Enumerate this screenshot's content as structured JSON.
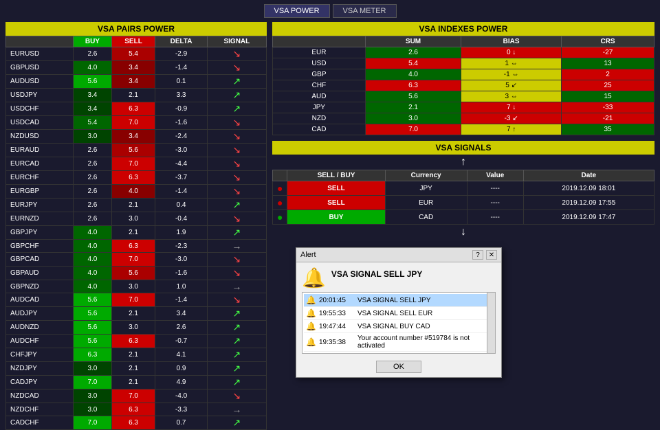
{
  "topBar": {
    "btn1": "VSA POWER",
    "btn2": "VSA METER"
  },
  "pairsPanel": {
    "title": "VSA PAIRS POWER",
    "headers": [
      "",
      "BUY",
      "SELL",
      "DELTA",
      "SIGNAL"
    ],
    "rows": [
      {
        "pair": "EURUSD",
        "buy": "2.6",
        "sell": "5.4",
        "delta": "-2.9",
        "signal": "down-red"
      },
      {
        "pair": "GBPUSD",
        "buy": "4.0",
        "sell": "3.4",
        "delta": "-1.4",
        "signal": "down-red"
      },
      {
        "pair": "AUDUSD",
        "buy": "5.6",
        "sell": "3.4",
        "delta": "0.1",
        "signal": "up-green"
      },
      {
        "pair": "USDJPY",
        "buy": "3.4",
        "sell": "2.1",
        "delta": "3.3",
        "signal": "up-green"
      },
      {
        "pair": "USDCHF",
        "buy": "3.4",
        "sell": "6.3",
        "delta": "-0.9",
        "signal": "up-green"
      },
      {
        "pair": "USDCAD",
        "buy": "5.4",
        "sell": "7.0",
        "delta": "-1.6",
        "signal": "down-red"
      },
      {
        "pair": "NZDUSD",
        "buy": "3.0",
        "sell": "3.4",
        "delta": "-2.4",
        "signal": "down-red"
      },
      {
        "pair": "EURAUD",
        "buy": "2.6",
        "sell": "5.6",
        "delta": "-3.0",
        "signal": "down-red"
      },
      {
        "pair": "EURCAD",
        "buy": "2.6",
        "sell": "7.0",
        "delta": "-4.4",
        "signal": "down-red"
      },
      {
        "pair": "EURCHF",
        "buy": "2.6",
        "sell": "6.3",
        "delta": "-3.7",
        "signal": "down-red"
      },
      {
        "pair": "EURGBP",
        "buy": "2.6",
        "sell": "4.0",
        "delta": "-1.4",
        "signal": "down-red"
      },
      {
        "pair": "EURJPY",
        "buy": "2.6",
        "sell": "2.1",
        "delta": "0.4",
        "signal": "up-green"
      },
      {
        "pair": "EURNZD",
        "buy": "2.6",
        "sell": "3.0",
        "delta": "-0.4",
        "signal": "down-red"
      },
      {
        "pair": "GBPJPY",
        "buy": "4.0",
        "sell": "2.1",
        "delta": "1.9",
        "signal": "up-green"
      },
      {
        "pair": "GBPCHF",
        "buy": "4.0",
        "sell": "6.3",
        "delta": "-2.3",
        "signal": "right-gray"
      },
      {
        "pair": "GBPCAD",
        "buy": "4.0",
        "sell": "7.0",
        "delta": "-3.0",
        "signal": "down-red"
      },
      {
        "pair": "GBPAUD",
        "buy": "4.0",
        "sell": "5.6",
        "delta": "-1.6",
        "signal": "down-red"
      },
      {
        "pair": "GBPNZD",
        "buy": "4.0",
        "sell": "3.0",
        "delta": "1.0",
        "signal": "right-gray"
      },
      {
        "pair": "AUDCAD",
        "buy": "5.6",
        "sell": "7.0",
        "delta": "-1.4",
        "signal": "down-red"
      },
      {
        "pair": "AUDJPY",
        "buy": "5.6",
        "sell": "2.1",
        "delta": "3.4",
        "signal": "up-green"
      },
      {
        "pair": "AUDNZD",
        "buy": "5.6",
        "sell": "3.0",
        "delta": "2.6",
        "signal": "up-green"
      },
      {
        "pair": "AUDCHF",
        "buy": "5.6",
        "sell": "6.3",
        "delta": "-0.7",
        "signal": "up-green"
      },
      {
        "pair": "CHFJPY",
        "buy": "6.3",
        "sell": "2.1",
        "delta": "4.1",
        "signal": "up-green"
      },
      {
        "pair": "NZDJPY",
        "buy": "3.0",
        "sell": "2.1",
        "delta": "0.9",
        "signal": "up-green"
      },
      {
        "pair": "CADJPY",
        "buy": "7.0",
        "sell": "2.1",
        "delta": "4.9",
        "signal": "up-green"
      },
      {
        "pair": "NZDCAD",
        "buy": "3.0",
        "sell": "7.0",
        "delta": "-4.0",
        "signal": "down-red"
      },
      {
        "pair": "NZDCHF",
        "buy": "3.0",
        "sell": "6.3",
        "delta": "-3.3",
        "signal": "right-gray"
      },
      {
        "pair": "CADCHF",
        "buy": "7.0",
        "sell": "6.3",
        "delta": "0.7",
        "signal": "up-green"
      }
    ]
  },
  "indexesPanel": {
    "title": "VSA INDEXES POWER",
    "headers": [
      "",
      "SUM",
      "BIAS",
      "CRS"
    ],
    "rows": [
      {
        "currency": "EUR",
        "sum": "2.6",
        "sum_color": "green",
        "bias": "0",
        "bias_color": "red",
        "bias_arrow": "down",
        "crs": "-27",
        "crs_color": "red"
      },
      {
        "currency": "USD",
        "sum": "5.4",
        "sum_color": "red",
        "bias": "1",
        "bias_color": "yellow",
        "bias_arrow": "right",
        "crs": "13",
        "crs_color": "green"
      },
      {
        "currency": "GBP",
        "sum": "4.0",
        "sum_color": "green",
        "bias": "-1",
        "bias_color": "yellow",
        "bias_arrow": "right",
        "crs": "2",
        "crs_color": "red"
      },
      {
        "currency": "CHF",
        "sum": "6.3",
        "sum_color": "red",
        "bias": "5",
        "bias_color": "yellow",
        "bias_arrow": "down2",
        "crs": "25",
        "crs_color": "red"
      },
      {
        "currency": "AUD",
        "sum": "5.6",
        "sum_color": "green",
        "bias": "3",
        "bias_color": "yellow",
        "bias_arrow": "right2",
        "crs": "15",
        "crs_color": "green"
      },
      {
        "currency": "JPY",
        "sum": "2.1",
        "sum_color": "green",
        "bias": "7",
        "bias_color": "red",
        "bias_arrow": "down",
        "crs": "-33",
        "crs_color": "red"
      },
      {
        "currency": "NZD",
        "sum": "3.0",
        "sum_color": "green",
        "bias": "-3",
        "bias_color": "red",
        "bias_arrow": "down2",
        "crs": "-21",
        "crs_color": "red"
      },
      {
        "currency": "CAD",
        "sum": "7.0",
        "sum_color": "red",
        "bias": "7",
        "bias_color": "yellow",
        "bias_arrow": "up",
        "crs": "35",
        "crs_color": "green"
      }
    ]
  },
  "signalsPanel": {
    "title": "VSA SIGNALS",
    "rows": [
      {
        "dot_color": "red",
        "action": "SELL",
        "currency": "JPY",
        "value": "----",
        "date": "2019.12.09 18:01"
      },
      {
        "dot_color": "red",
        "action": "SELL",
        "currency": "EUR",
        "value": "----",
        "date": "2019.12.09 17:55"
      },
      {
        "dot_color": "green",
        "action": "BUY",
        "currency": "CAD",
        "value": "----",
        "date": "2019.12.09 17:47"
      }
    ]
  },
  "alertDialog": {
    "title": "Alert",
    "help_btn": "?",
    "close_btn": "✕",
    "bell_icon": "🔔",
    "main_msg": "VSA SIGNAL SELL JPY",
    "log_rows": [
      {
        "time": "20:01:45",
        "msg": "VSA SIGNAL SELL JPY",
        "highlight": true
      },
      {
        "time": "19:55:33",
        "msg": "VSA SIGNAL SELL EUR",
        "highlight": false
      },
      {
        "time": "19:47:44",
        "msg": "VSA SIGNAL BUY CAD",
        "highlight": false
      },
      {
        "time": "19:35:38",
        "msg": "Your account number #519784 is not activated",
        "highlight": false
      }
    ],
    "ok_label": "OK"
  }
}
